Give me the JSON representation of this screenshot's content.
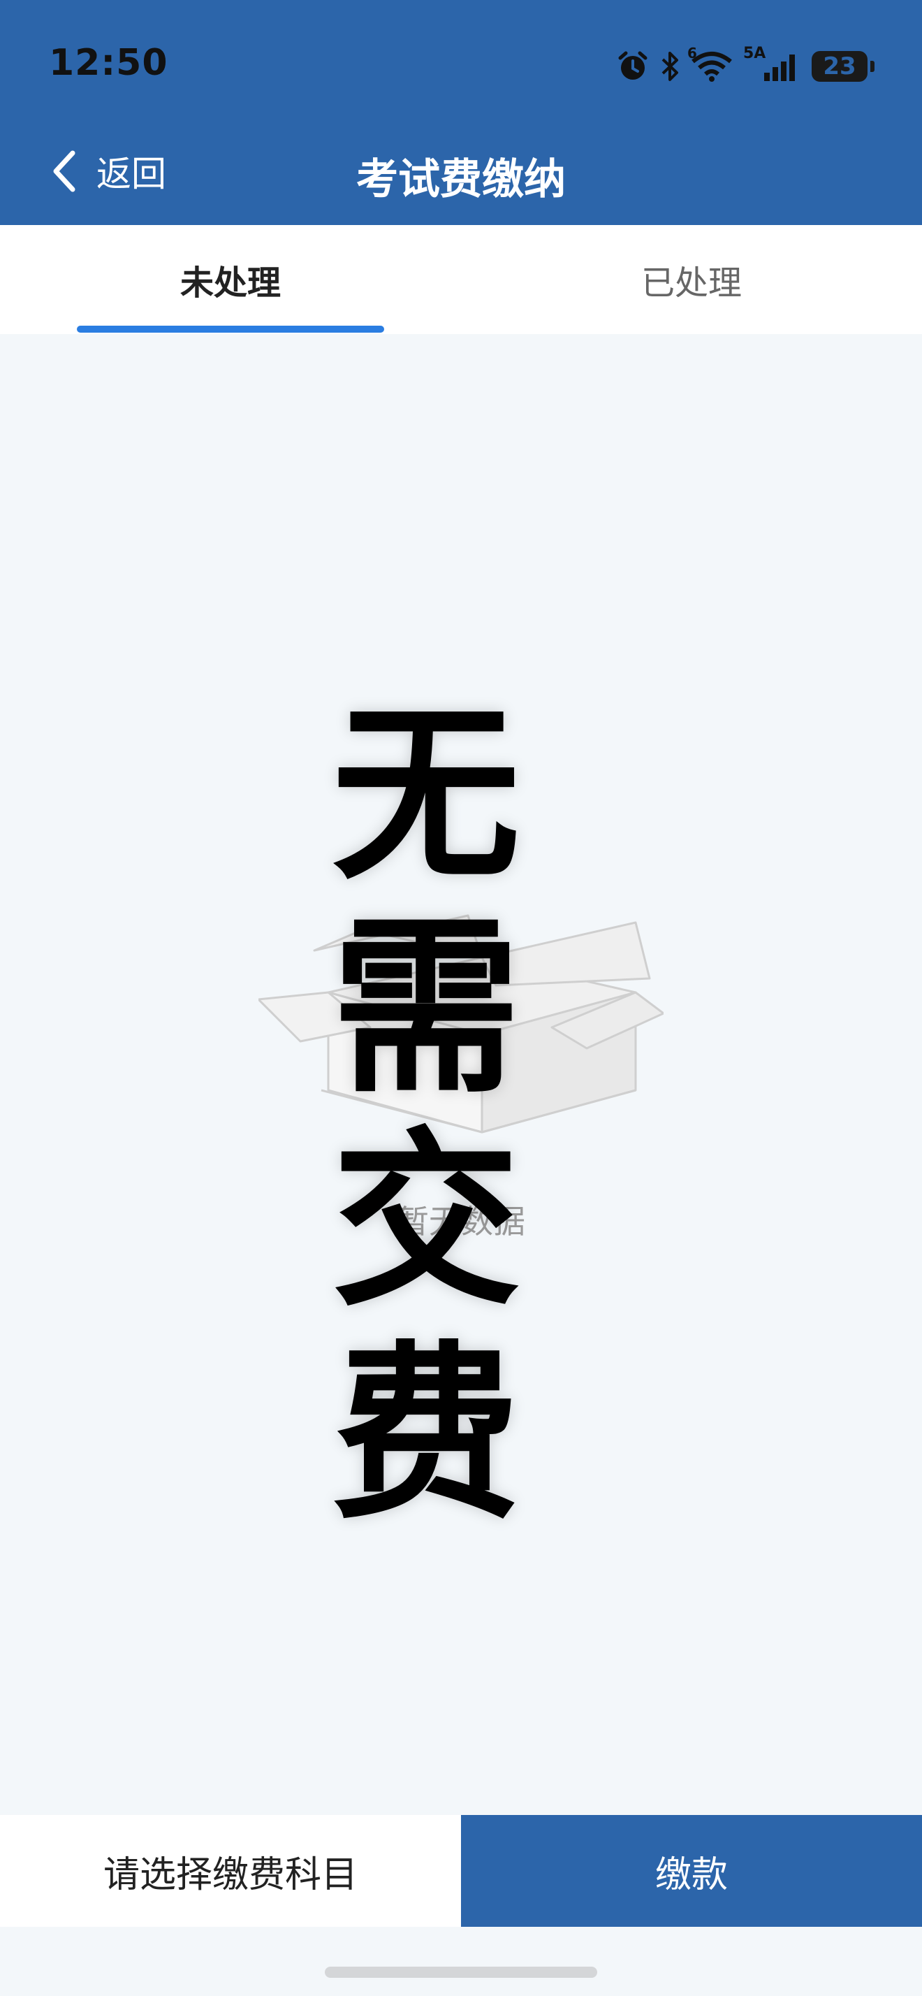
{
  "status_bar": {
    "time": "12:50",
    "network": "5A",
    "wifi_badge": "6",
    "battery": "23"
  },
  "header": {
    "back_label": "返回",
    "title": "考试费缴纳"
  },
  "tabs": [
    {
      "label": "未处理",
      "active": true
    },
    {
      "label": "已处理",
      "active": false
    }
  ],
  "empty_state": {
    "icon": "empty-box-icon",
    "text": "暂无数据"
  },
  "overlay_watermark": [
    "无",
    "需",
    "交",
    "费"
  ],
  "bottom_bar": {
    "select_label": "请选择缴费科目",
    "pay_label": "缴款"
  },
  "colors": {
    "header_bg": "#2c65aa",
    "tab_indicator": "#2a7de1",
    "pay_button_bg": "#2c65aa",
    "page_bg": "#f3f7fa"
  }
}
